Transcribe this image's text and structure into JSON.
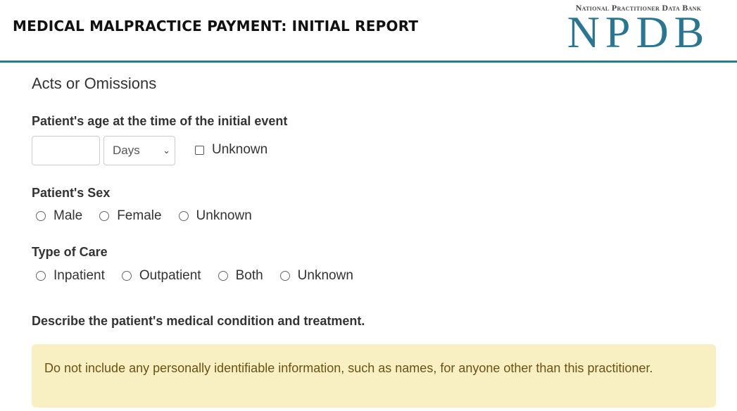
{
  "header": {
    "title": "MEDICAL MALPRACTICE PAYMENT: INITIAL REPORT",
    "logo_small": "National Practitioner Data Bank",
    "logo_big": "NPDB",
    "accent_color": "#1a8291"
  },
  "section": {
    "title": "Acts or Omissions"
  },
  "age": {
    "label": "Patient's age at the time of the initial event",
    "value": "",
    "unit_selected": "Days",
    "unknown_label": "Unknown",
    "unknown_checked": false
  },
  "sex": {
    "label": "Patient's Sex",
    "options": [
      "Male",
      "Female",
      "Unknown"
    ]
  },
  "care": {
    "label": "Type of Care",
    "options": [
      "Inpatient",
      "Outpatient",
      "Both",
      "Unknown"
    ]
  },
  "describe": {
    "label": "Describe the patient's medical condition and treatment.",
    "alert": "Do not include any personally identifiable information, such as names, for anyone other than this practitioner."
  }
}
